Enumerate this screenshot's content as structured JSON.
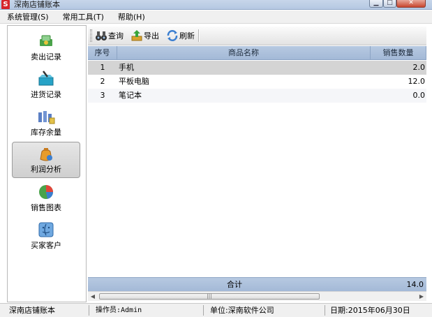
{
  "window": {
    "title": "深南店铺账本",
    "app_icon": "S"
  },
  "menu": [
    "系统管理(S)",
    "常用工具(T)",
    "帮助(H)"
  ],
  "sidebar": {
    "items": [
      {
        "label": "卖出记录",
        "icon": "sell-icon"
      },
      {
        "label": "进货记录",
        "icon": "purchase-icon"
      },
      {
        "label": "库存余量",
        "icon": "inventory-icon"
      },
      {
        "label": "利润分析",
        "icon": "profit-icon",
        "active": true
      },
      {
        "label": "销售图表",
        "icon": "pie-chart-icon"
      },
      {
        "label": "买家客户",
        "icon": "customer-icon"
      }
    ]
  },
  "toolbar": {
    "query": "查询",
    "export": "导出",
    "refresh": "刷新"
  },
  "table": {
    "columns": [
      "序号",
      "商品名称",
      "销售数量"
    ],
    "rows": [
      {
        "no": "1",
        "name": "手机",
        "qty": "2.0"
      },
      {
        "no": "2",
        "name": "平板电脑",
        "qty": "12.0"
      },
      {
        "no": "3",
        "name": "笔记本",
        "qty": "0.0"
      }
    ],
    "summary_label": "合计",
    "summary_value": "14.0"
  },
  "status": {
    "app": "深南店铺账本",
    "operator": "操作员:Admin",
    "unit": "单位:深南软件公司",
    "date": "日期:2015年06月30日"
  },
  "colors": {
    "header": "#a3b9d7",
    "selected_row": "#d4d4d4",
    "close_button": "#c8462e"
  }
}
